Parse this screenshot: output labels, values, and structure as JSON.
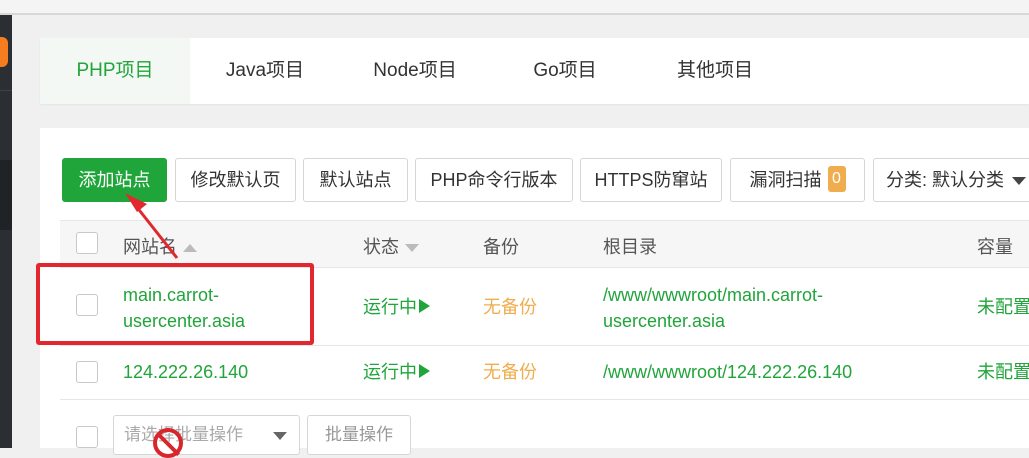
{
  "tabs": [
    {
      "label": "PHP项目",
      "active": true
    },
    {
      "label": "Java项目",
      "active": false
    },
    {
      "label": "Node项目",
      "active": false
    },
    {
      "label": "Go项目",
      "active": false
    },
    {
      "label": "其他项目",
      "active": false
    }
  ],
  "toolbar": {
    "add_site": "添加站点",
    "edit_default_page": "修改默认页",
    "default_site": "默认站点",
    "php_cli_version": "PHP命令行版本",
    "https_anti_hijack": "HTTPS防窜站",
    "vuln_scan": "漏洞扫描",
    "vuln_count": "0",
    "category": "分类: 默认分类"
  },
  "table": {
    "headers": {
      "site_name": "网站名",
      "status": "状态",
      "backup": "备份",
      "root_dir": "根目录",
      "capacity": "容量"
    },
    "rows": [
      {
        "name_line1": "main.carrot-",
        "name_line2": "usercenter.asia",
        "status": "运行中",
        "backup": "无备份",
        "root_line1": "/www/wwwroot/main.carrot-",
        "root_line2": "usercenter.asia",
        "capacity": "未配置"
      },
      {
        "name": "124.222.26.140",
        "status": "运行中",
        "backup": "无备份",
        "root": "/www/wwwroot/124.222.26.140",
        "capacity": "未配置"
      }
    ]
  },
  "footer": {
    "batch_placeholder": "请选择批量操作",
    "batch_button": "批量操作"
  },
  "colors": {
    "accent_green": "#20a53a",
    "warning_orange": "#f0ad4e",
    "annotation_red": "#e0282e"
  }
}
